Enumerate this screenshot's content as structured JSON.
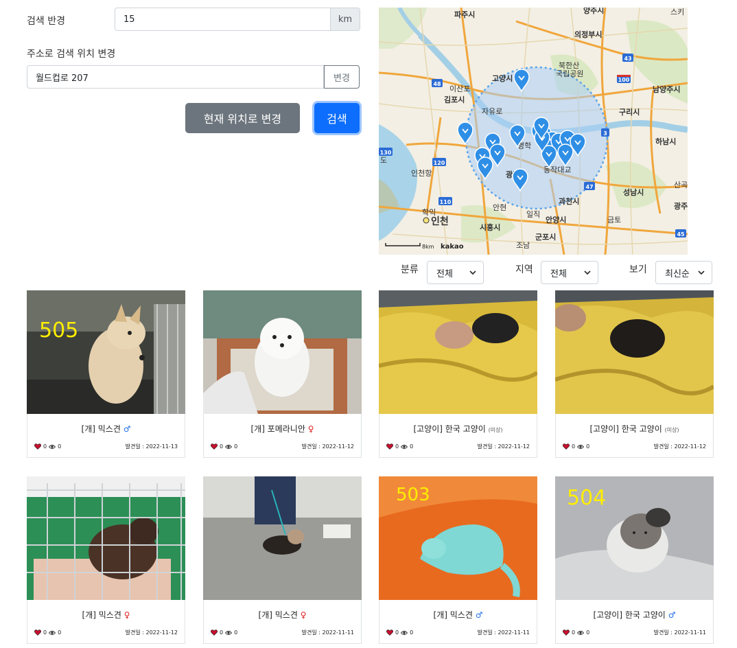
{
  "search": {
    "radius_label": "검색 반경",
    "radius_value": "15",
    "radius_unit": "km",
    "address_label": "주소로 검색 위치 변경",
    "address_value": "월드컵로 207",
    "change_button": "변경",
    "current_location_button": "현재 위치로 변경",
    "search_button": "검색"
  },
  "map": {
    "places": [
      "파주시",
      "양주시",
      "의정부시",
      "고양시",
      "남양주시",
      "김포시",
      "구리시",
      "하남시",
      "인천항",
      "광명시",
      "성남시",
      "과천시",
      "광주",
      "인천",
      "시흥시",
      "안양시",
      "군포시",
      "북한산",
      "국립공원",
      "이산포",
      "동작대교",
      "학익",
      "안현",
      "일직",
      "금토",
      "조남",
      "자유로",
      "스키",
      "산곡",
      "명학",
      "도"
    ],
    "road_numbers": [
      "43",
      "48",
      "100",
      "130",
      "120",
      "110",
      "47",
      "3",
      "45"
    ],
    "scale_text": "8km",
    "brand": "kakao"
  },
  "filters": {
    "category_label": "분류",
    "category_value": "전체",
    "region_label": "지역",
    "region_value": "전체",
    "view_label": "보기",
    "view_value": "최신순"
  },
  "cards": [
    {
      "title": "[개] 믹스견",
      "sex": "♂",
      "sex_color": "#1e6ee8",
      "note": "",
      "likes": "0",
      "views": "0",
      "date": "발견일 : 2022-11-13",
      "photo_tag": "505"
    },
    {
      "title": "[개] 포메라니안",
      "sex": "♀",
      "sex_color": "#e02020",
      "note": "",
      "likes": "0",
      "views": "0",
      "date": "발견일 : 2022-11-12",
      "photo_tag": ""
    },
    {
      "title": "[고양이] 한국 고양이",
      "sex": "",
      "sex_color": "",
      "note": "(미상)",
      "likes": "0",
      "views": "0",
      "date": "발견일 : 2022-11-12",
      "photo_tag": ""
    },
    {
      "title": "[고양이] 한국 고양이",
      "sex": "",
      "sex_color": "",
      "note": "(미상)",
      "likes": "0",
      "views": "0",
      "date": "발견일 : 2022-11-12",
      "photo_tag": ""
    },
    {
      "title": "[개] 믹스견",
      "sex": "♀",
      "sex_color": "#e02020",
      "note": "",
      "likes": "0",
      "views": "0",
      "date": "발견일 : 2022-11-12",
      "photo_tag": ""
    },
    {
      "title": "[개] 믹스견",
      "sex": "♀",
      "sex_color": "#e02020",
      "note": "",
      "likes": "0",
      "views": "0",
      "date": "발견일 : 2022-11-11",
      "photo_tag": ""
    },
    {
      "title": "[개] 믹스견",
      "sex": "♂",
      "sex_color": "#1e6ee8",
      "note": "",
      "likes": "0",
      "views": "0",
      "date": "발견일 : 2022-11-11",
      "photo_tag": "503"
    },
    {
      "title": "[고양이] 한국 고양이",
      "sex": "♂",
      "sex_color": "#1e6ee8",
      "note": "",
      "likes": "0",
      "views": "0",
      "date": "발견일 : 2022-11-11",
      "photo_tag": "504"
    }
  ]
}
